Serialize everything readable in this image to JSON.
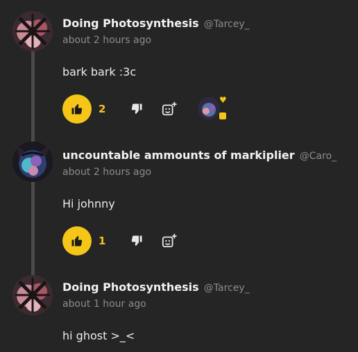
{
  "comments": [
    {
      "display_name": "Doing Photosynthesis",
      "handle": "@Tarcey_",
      "timestamp": "about 2 hours ago",
      "body": "bark bark :3c",
      "likes": "2",
      "avatar": "flower-avatar"
    },
    {
      "display_name": "uncountable ammounts of markiplier",
      "handle": "@Caro_",
      "timestamp": "about 2 hours ago",
      "body": "Hi johnny",
      "likes": "1",
      "avatar": "cat-ear-avatar"
    },
    {
      "display_name": "Doing Photosynthesis",
      "handle": "@Tarcey_",
      "timestamp": "about 1 hour ago",
      "body": "hi ghost >_<",
      "avatar": "flower-avatar"
    }
  ],
  "icons": {
    "like": "thumbs-up-icon",
    "dislike": "thumbs-down-icon",
    "react": "add-reaction-icon",
    "reaction": "heart-icon"
  },
  "colors": {
    "background": "#252526",
    "accent": "#f5c518",
    "muted_text": "#8c8c8c",
    "thread_line": "#4a4a4c"
  }
}
